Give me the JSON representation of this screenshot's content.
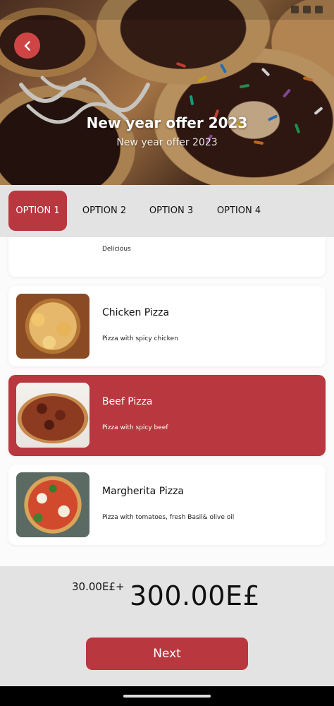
{
  "header": {
    "title": "New year offer 2023",
    "subtitle": "New year offer 2023"
  },
  "tabs": [
    {
      "label": "OPTION 1",
      "active": true
    },
    {
      "label": "OPTION 2",
      "active": false
    },
    {
      "label": "OPTION 3",
      "active": false
    },
    {
      "label": "OPTION 4",
      "active": false
    }
  ],
  "items": [
    {
      "title": "",
      "description": "Delicious",
      "image": "pizza-image"
    },
    {
      "title": "Chicken Pizza",
      "description": "Pizza with spicy chicken",
      "image": "chicken-pizza-image"
    },
    {
      "title": "Beef Pizza",
      "description": "Pizza with spicy beef",
      "image": "beef-pizza-image",
      "selected": true
    },
    {
      "title": "Margherita Pizza",
      "description": "Pizza with tomatoes, fresh Basil& olive oil",
      "image": "margherita-pizza-image"
    }
  ],
  "footer": {
    "old_price": "30.00E£+",
    "total_price": "300.00E£",
    "next_label": "Next"
  },
  "icons": {
    "back": "chevron-left-icon"
  },
  "colors": {
    "accent": "#b9373e",
    "back_button": "#cf4444",
    "panel_bg": "#e4e3e4"
  }
}
